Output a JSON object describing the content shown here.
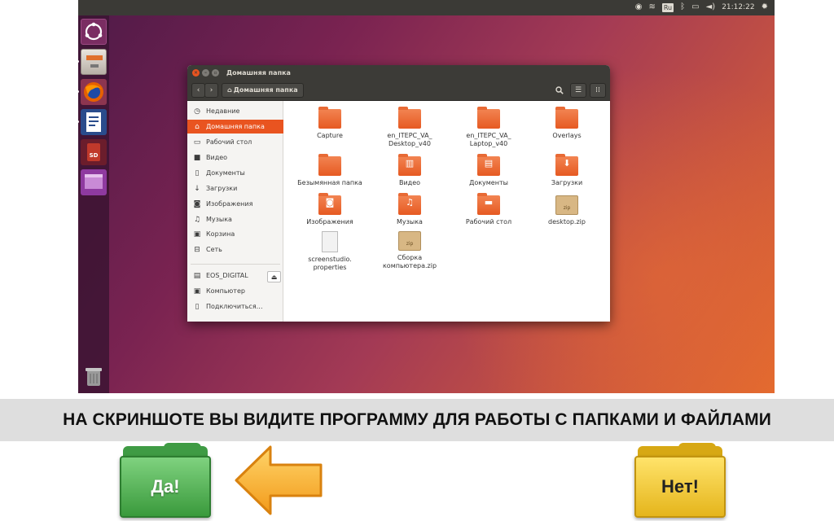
{
  "topbar": {
    "keyboard_layout": "Ru",
    "clock": "21:12:22",
    "icons": [
      "telegram-icon",
      "wifi-icon",
      "bluetooth-icon",
      "battery-icon",
      "volume-icon",
      "gear-icon"
    ]
  },
  "launcher": {
    "items": [
      "ubuntu-dash-icon",
      "files-icon",
      "firefox-icon",
      "writer-icon",
      "sd-card-icon",
      "window-icon",
      "trash-icon"
    ]
  },
  "window": {
    "title": "Домашняя папка",
    "breadcrumb": "Домашняя папка",
    "sidebar": [
      {
        "label": "Недавние",
        "icon": "recent-icon",
        "glyph": "◷"
      },
      {
        "label": "Домашняя папка",
        "icon": "home-icon",
        "glyph": "⌂",
        "active": true
      },
      {
        "label": "Рабочий стол",
        "icon": "desktop-icon",
        "glyph": "▭"
      },
      {
        "label": "Видео",
        "icon": "video-icon",
        "glyph": "■"
      },
      {
        "label": "Документы",
        "icon": "documents-icon",
        "glyph": "▯"
      },
      {
        "label": "Загрузки",
        "icon": "downloads-icon",
        "glyph": "↓"
      },
      {
        "label": "Изображения",
        "icon": "pictures-icon",
        "glyph": "◙"
      },
      {
        "label": "Музыка",
        "icon": "music-icon",
        "glyph": "♫"
      },
      {
        "label": "Корзина",
        "icon": "trash-icon",
        "glyph": "▣"
      },
      {
        "label": "Сеть",
        "icon": "network-icon",
        "glyph": "⊟"
      },
      {
        "label": "EOS_DIGITAL",
        "icon": "drive-icon",
        "glyph": "▤"
      },
      {
        "label": "Компьютер",
        "icon": "computer-icon",
        "glyph": "▣"
      },
      {
        "label": "Подключиться…",
        "icon": "connect-icon",
        "glyph": "▯"
      }
    ],
    "files": [
      {
        "name": "Capture",
        "kind": "folder"
      },
      {
        "name": "en_ITEPC_VA_ Desktop_v40",
        "kind": "folder"
      },
      {
        "name": "en_ITEPC_VA_ Laptop_v40",
        "kind": "folder"
      },
      {
        "name": "Overlays",
        "kind": "folder"
      },
      {
        "name": "Безымянная папка",
        "kind": "folder"
      },
      {
        "name": "Видео",
        "kind": "folder"
      },
      {
        "name": "Документы",
        "kind": "folder"
      },
      {
        "name": "Загрузки",
        "kind": "folder"
      },
      {
        "name": "Изображения",
        "kind": "folder"
      },
      {
        "name": "Музыка",
        "kind": "folder"
      },
      {
        "name": "Рабочий стол",
        "kind": "folder"
      },
      {
        "name": "desktop.zip",
        "kind": "zip"
      },
      {
        "name": "screenstudio. properties",
        "kind": "doc"
      },
      {
        "name": "Сборка компьютера.zip",
        "kind": "zip"
      }
    ],
    "zip_label": "zip"
  },
  "quiz": {
    "question": "НА СКРИНШОТЕ ВЫ ВИДИТЕ ПРОГРАММУ ДЛЯ РАБОТЫ С ПАПКАМИ И ФАЙЛАМИ",
    "yes_label": "Да!",
    "no_label": "Нет!"
  },
  "colors": {
    "accent": "#e95420",
    "yes_green": "#4fb24f",
    "no_yellow": "#f3c73a",
    "arrow_orange": "#f5a623"
  }
}
